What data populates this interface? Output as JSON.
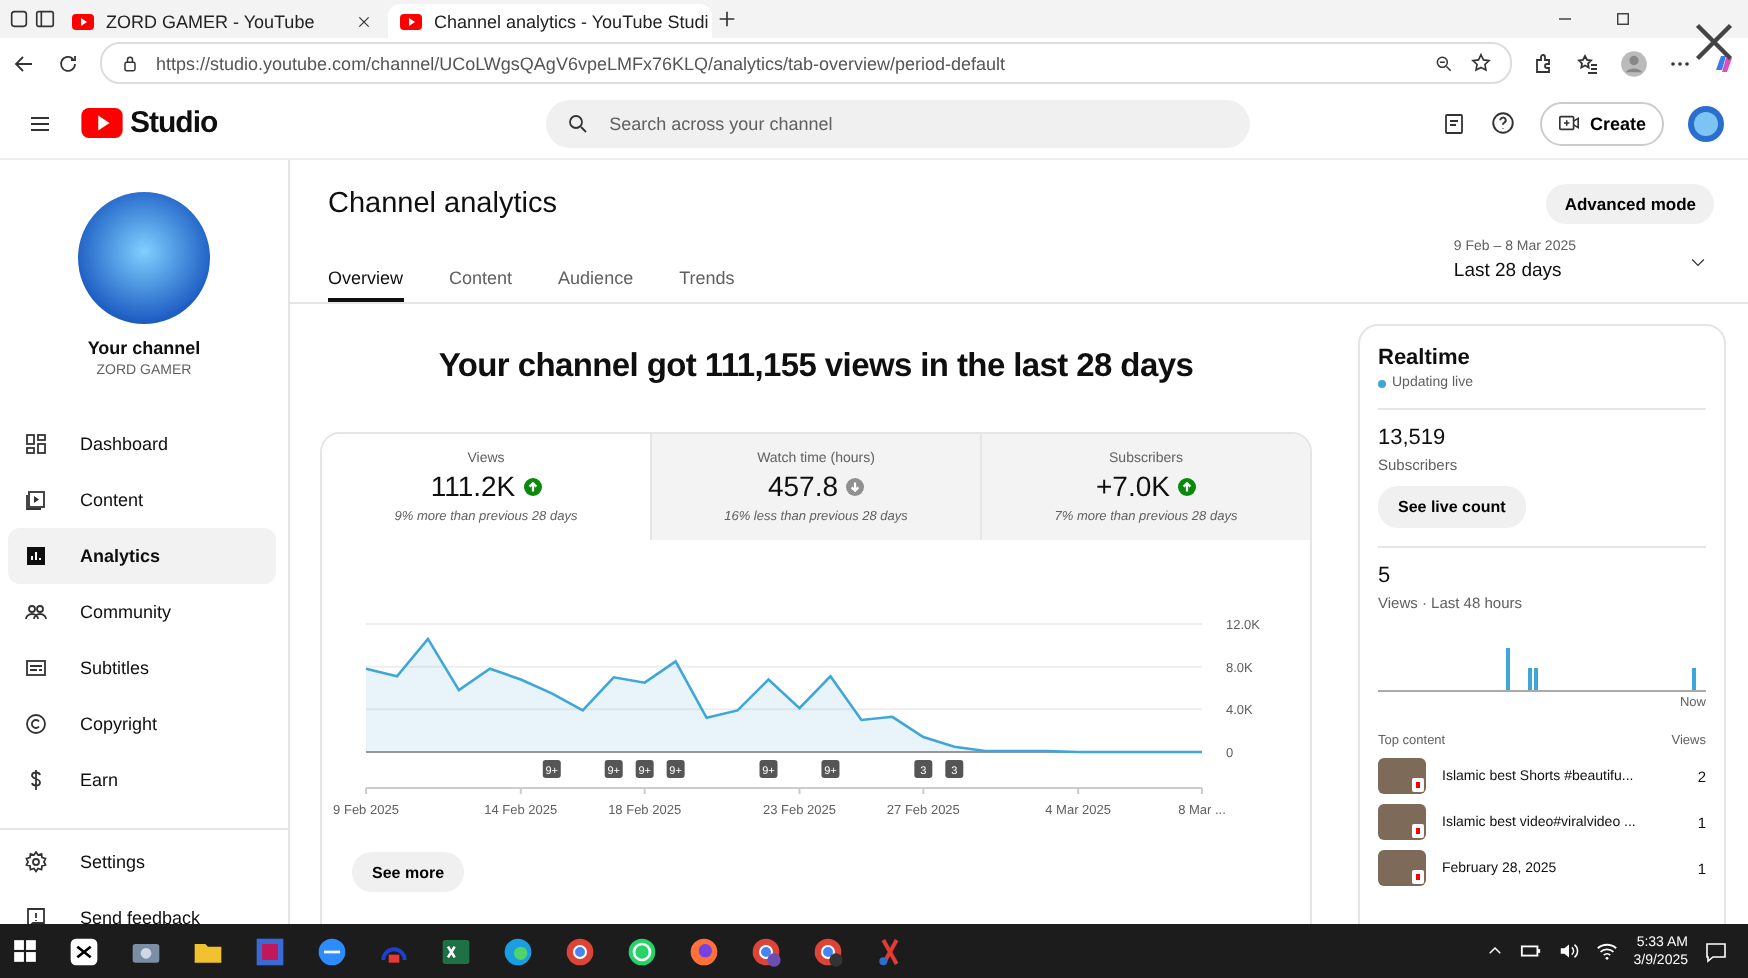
{
  "browser": {
    "tabs": [
      {
        "title": "ZORD GAMER - YouTube",
        "selected": false
      },
      {
        "title": "Channel analytics - YouTube Studi",
        "selected": true
      }
    ],
    "url": "https://studio.youtube.com/channel/UCoLWgsQAgV6vpeLMFx76KLQ/analytics/tab-overview/period-default"
  },
  "header": {
    "logo": "Studio",
    "search_placeholder": "Search across your channel",
    "create": "Create"
  },
  "sidebar": {
    "channel_label": "Your channel",
    "channel_name": "ZORD GAMER",
    "items": [
      {
        "label": "Dashboard",
        "selected": false
      },
      {
        "label": "Content",
        "selected": false
      },
      {
        "label": "Analytics",
        "selected": true
      },
      {
        "label": "Community",
        "selected": false
      },
      {
        "label": "Subtitles",
        "selected": false
      },
      {
        "label": "Copyright",
        "selected": false
      },
      {
        "label": "Earn",
        "selected": false
      }
    ],
    "footer_items": [
      {
        "label": "Settings"
      },
      {
        "label": "Send feedback"
      }
    ]
  },
  "page": {
    "title": "Channel analytics",
    "tabs": [
      {
        "label": "Overview",
        "selected": true
      },
      {
        "label": "Content",
        "selected": false
      },
      {
        "label": "Audience",
        "selected": false
      },
      {
        "label": "Trends",
        "selected": false
      }
    ],
    "advanced_mode": "Advanced mode",
    "date_range": "9 Feb – 8 Mar 2025",
    "period": "Last 28 days",
    "headline": "Your channel got 111,155 views in the last 28 days",
    "metrics": [
      {
        "label": "Views",
        "value": "111.2K",
        "increase": true,
        "note": "9% more than previous 28 days",
        "selected": true
      },
      {
        "label": "Watch time (hours)",
        "value": "457.8",
        "increase": false,
        "note": "16% less than previous 28 days",
        "selected": false
      },
      {
        "label": "Subscribers",
        "value": "+7.0K",
        "increase": true,
        "note": "7% more than previous 28 days",
        "selected": false
      }
    ],
    "chart_data": {
      "type": "area",
      "categories": [
        "9 Feb 2025",
        null,
        null,
        null,
        null,
        "14 Feb 2025",
        null,
        null,
        null,
        "18 Feb 2025",
        null,
        null,
        null,
        null,
        "23 Feb 2025",
        null,
        null,
        null,
        "27 Feb 2025",
        null,
        null,
        null,
        null,
        "4 Mar 2025",
        null,
        null,
        null,
        "8 Mar ..."
      ],
      "values": [
        7800,
        7100,
        10600,
        5800,
        7800,
        6800,
        5500,
        3900,
        7000,
        6500,
        8500,
        3200,
        3900,
        6800,
        4100,
        7100,
        3000,
        3300,
        1400,
        500,
        100,
        100,
        100,
        0,
        0,
        0,
        0,
        0
      ],
      "ylim": [
        0,
        12000
      ],
      "yticks": [
        {
          "value": 0,
          "label": "0"
        },
        {
          "value": 4000,
          "label": "4.0K"
        },
        {
          "value": 8000,
          "label": "8.0K"
        },
        {
          "value": 12000,
          "label": "12.0K"
        }
      ],
      "annotations": [
        "9+",
        "9+",
        "9+",
        "9+",
        "9+",
        "9+",
        "3",
        "3"
      ]
    },
    "see_more": "See more"
  },
  "realtime": {
    "title": "Realtime",
    "status": "Updating live",
    "subscribers": "13,519",
    "subscribers_label": "Subscribers",
    "live_button": "See live count",
    "views": "5",
    "views_label": "Views · Last 48 hours",
    "axis_label": "Now",
    "top_content_label": "Top content",
    "views_column": "Views",
    "items": [
      {
        "title": "Islamic best Shorts #beautifu...",
        "views": "2"
      },
      {
        "title": "Islamic best video#viralvideo ...",
        "views": "1"
      },
      {
        "title": "February 28, 2025",
        "views": "1"
      }
    ]
  },
  "taskbar": {
    "time": "5:33 AM",
    "date": "3/9/2025"
  }
}
